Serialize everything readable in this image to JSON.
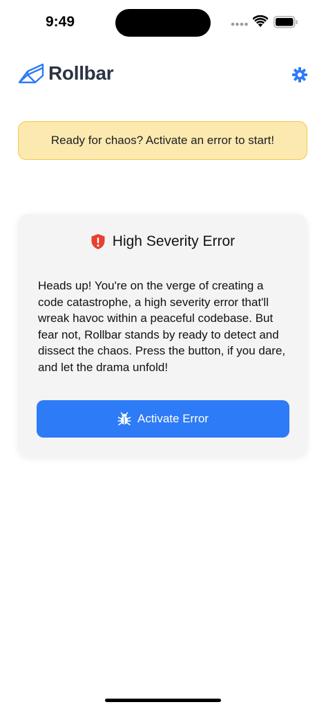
{
  "status_bar": {
    "time": "9:49"
  },
  "header": {
    "app_name": "Rollbar",
    "logo_icon": "rollbar-logo-icon",
    "settings_icon": "gear-icon",
    "accent_color": "#2d7bf6"
  },
  "banner": {
    "text": "Ready for chaos? Activate an error to start!",
    "background": "#fbe9b0",
    "border": "#f2c94c"
  },
  "card": {
    "icon": "shield-alert-icon",
    "icon_color": "#e8412f",
    "title": "High Severity Error",
    "body": "Heads up! You're on the verge of creating a code catastrophe, a high severity error that'll wreak havoc within a peaceful codebase. But fear not, Rollbar stands by ready to detect and dissect the chaos. Press the button, if you dare, and let the drama unfold!",
    "button": {
      "icon": "bug-icon",
      "label": "Activate Error",
      "color": "#2d7bf6"
    }
  }
}
